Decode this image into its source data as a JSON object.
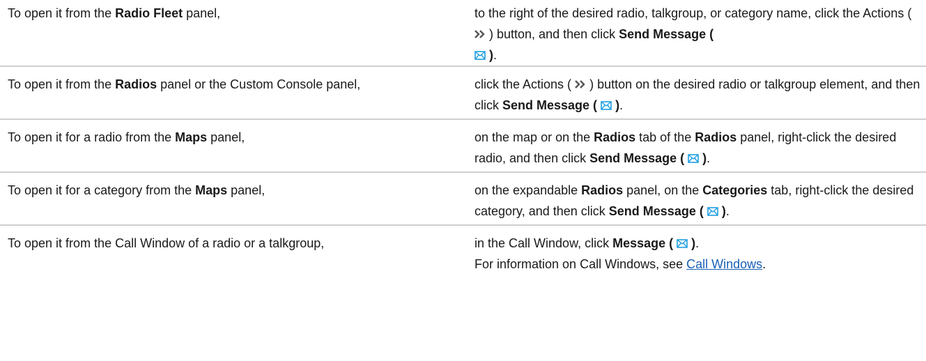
{
  "rows": [
    {
      "left": [
        "To open it from the ",
        "Radio Fleet",
        " panel,"
      ],
      "right": {
        "t1": "to the right of the desired radio, talkgroup, or category name, click the Actions (",
        "t2": ") button, and then click ",
        "b1": "Send Message (",
        "b2": ")",
        "t3": "."
      }
    },
    {
      "left": [
        "To open it from the ",
        "Radios",
        " panel or the Custom Console panel,"
      ],
      "right": {
        "t1": "click the Actions (",
        "t2": ") button on the desired radio or talkgroup element, and then click ",
        "b1": "Send Message (",
        "b2": ")",
        "t3": "."
      }
    },
    {
      "left": [
        "To open it for a radio from the ",
        "Maps",
        " panel,"
      ],
      "right": {
        "t1": "on the map or on the ",
        "b1": "Radios",
        "t2": " tab of the ",
        "b2": "Radios",
        "t3": " panel, right-click the desired radio, and then click ",
        "b3": "Send Message (",
        "b4": ")",
        "t4": "."
      }
    },
    {
      "left": [
        "To open it for a category from the ",
        "Maps",
        " panel,"
      ],
      "right": {
        "t1": "on the expandable ",
        "b1": "Radios",
        "t2": " panel, on the ",
        "b2": "Categories",
        "t3": " tab, right-click the desired category, and then click ",
        "b3": "Send Message (",
        "b4": ")",
        "t4": "."
      }
    },
    {
      "left": [
        "To open it from the Call Window of a radio or a talkgroup,"
      ],
      "right": {
        "t1": "in the Call Window, click ",
        "b1": "Message (",
        "b2": ")",
        "t2": ".",
        "t3": "For information on Call Windows, see ",
        "link": "Call Windows",
        "t4": "."
      }
    }
  ],
  "icons": {
    "actions": "double-chevron-right-icon",
    "message": "envelope-icon",
    "accent_color": "#1e9fe0",
    "chevron_color": "#555555",
    "link_color": "#1a5fb4"
  }
}
